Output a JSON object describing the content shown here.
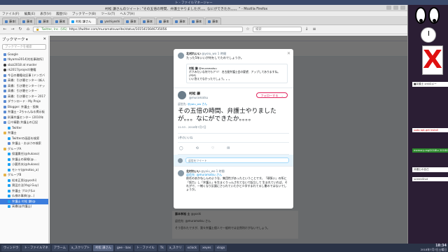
{
  "desktop": {
    "top_title": "ト - ファイルマネージャー"
  },
  "firefox": {
    "window_title": "村松 謙さんのツイート: \"その五倍の時間、弁護士やりましたが。。。なにができたか。。。。\" - Mozilla Firefox",
    "menu": [
      "ファイル(F)",
      "編集(E)",
      "表示(V)",
      "履歴(S)",
      "ブックマーク(B)",
      "ツール(T)",
      "ヘルプ(H)"
    ],
    "tabs": [
      "藤本(",
      "藤本",
      "藤本",
      "藤本",
      "村松 謙さん",
      "yoshiyoshi",
      "藤本",
      "藤本",
      "藤本",
      "藤本",
      "藤本",
      "藤本"
    ],
    "url": {
      "lock": "🔒",
      "site": "Twitter, Inc. (US)",
      "address": "https://twitter.com/muramatsuwrite/status/1015415646735056"
    },
    "search_placeholder": "検索"
  },
  "sidebar": {
    "title": "ブックマーク ▾",
    "search_placeholder": "ブックマークを検索",
    "items": [
      {
        "label": "Google",
        "icon": "google-favicon"
      },
      {
        "label": "tbyama2014[村松事務所]",
        "icon": "favicon"
      },
      {
        "label": "sbzz2018 at master",
        "icon": "github-favicon"
      },
      {
        "label": "rk2017/project/書籍",
        "icon": "github-favicon"
      },
      {
        "label": "今日の書籍化記事 (ドンガバ",
        "icon": "favicon"
      },
      {
        "label": "高橋：引き籠センター (新人",
        "icon": "favicon"
      },
      {
        "label": "高橋：引き籠センター (ヤッ",
        "icon": "favicon"
      },
      {
        "label": "高橋：引き籠センター",
        "icon": "favicon"
      },
      {
        "label": "高橋：引き籠センター 2017",
        "icon": "favicon"
      },
      {
        "label": "ダウンロード - My Proje",
        "icon": "favicon"
      },
      {
        "label": "Blogger: 弁護士 - 投稿",
        "icon": "favicon"
      },
      {
        "label": "弁護士・2ちゃんねる掲示板",
        "icon": "favicon"
      },
      {
        "label": "刑事弁護センター (2010年",
        "icon": "favicon"
      },
      {
        "label": "日々精勤 弁護士の日記",
        "icon": "favicon"
      },
      {
        "label": "Twitter",
        "icon": "twitter-favicon"
      },
      {
        "label": "弁護士",
        "icon": "folder"
      },
      {
        "label": "Twitterの画面を検索",
        "icon": "twitter-favicon"
      },
      {
        "label": "弁護士 - おまけの検索",
        "icon": "favicon"
      },
      {
        "label": "グループA",
        "icon": "folder"
      },
      {
        "label": "保護責任(@hukaso)",
        "icon": "twitter-favicon"
      },
      {
        "label": "弁護士の資格(@...",
        "icon": "twitter-favicon"
      },
      {
        "label": "小藪秀夫(@hukaso)",
        "icon": "twitter-favicon"
      },
      {
        "label": "モトヤ(@motoo_a)",
        "icon": "twitter-favicon"
      },
      {
        "label": "グループB",
        "icon": "folder"
      },
      {
        "label": "松本正男(@yoshi)",
        "icon": "twitter-favicon"
      },
      {
        "label": "黒田方法(Yogi Guy)",
        "icon": "twitter-favicon"
      },
      {
        "label": "弁護士 ブログ(Lo",
        "icon": "twitter-favicon"
      },
      {
        "label": "仏様の事典(@...)",
        "icon": "twitter-favicon"
      },
      {
        "label": "弁護士 村松 謙(@",
        "icon": "twitter-favicon",
        "selected": true
      },
      {
        "label": "高橋(@弁護士)",
        "icon": "twitter-favicon"
      }
    ]
  },
  "modal": {
    "close": "✕",
    "context": {
      "name": "北村れいい",
      "handle": "@yoiu_wo",
      "time": "1 時間",
      "text": "たった5年いいが何をしてたのでしょうか。",
      "quote_author": "村松 謙",
      "quote_handle": "@muramatsu",
      "quote_text": "ボクみたいな何でもアリ！ 名古屋弁護士会の要望、アップしてありますね。(PDF)",
      "quote_sub": "いい答えでなかったでしょう。。。"
    },
    "main": {
      "name": "村松 謙",
      "handle": "@muramatsu",
      "follow_label": "フォローする",
      "reply_to_prefix": "返信先:",
      "reply_to_handle": "@yoiu_wo さん",
      "text": "その五倍の時間、弁護士やりましたが。。。なにができたか。。。。",
      "time": "11:53 - 2018年7月7日",
      "stats": "1件のいいね",
      "actions": [
        "◯",
        "⟲",
        "♡",
        "✉"
      ]
    },
    "reply_box_placeholder": "返信をツイート",
    "reply": {
      "name": "北村れいい",
      "handle": "@yoiu_wo",
      "time": "1 時間",
      "to": "返信先: @muramatsu さん",
      "text": "前任のあかねしんのような、集団性があったということです。「頑張い」の所に「努力」し「弁護士」を生まくりっんされてないで起立して 生まれていれば、それがで、一緒くなり反論にさられていたかと少学すまれてるし書のではないでしょうか。"
    }
  },
  "background_tweet": {
    "name": "藤本孝裕 士",
    "handle": "@yoshi",
    "to": "返信先: @muramatsu さん",
    "text": "そう思わたですが、我々弁護士個人で一般的では全然利けがないでしょう。"
  },
  "right_panel": {
    "x_glyph": "X",
    "notes": [
      "■弁護士 xmlのメー",
      "sudo apt-get install",
      "memory-regi2018tv 2018X",
      "弁護士の自己",
      "screenShot"
    ]
  },
  "taskbar": {
    "items": [
      "ウィンドウ",
      "ト - ファイルマネ",
      "アラーム",
      "a_スクリプト",
      "村松 謙さん",
      "gee - bas",
      "ト - ファイル",
      "Tk",
      "a_スクリ",
      "xclock",
      "xeyes",
      "xlogo"
    ],
    "time": "18:34",
    "date": "2018年7月7日土曜日"
  }
}
